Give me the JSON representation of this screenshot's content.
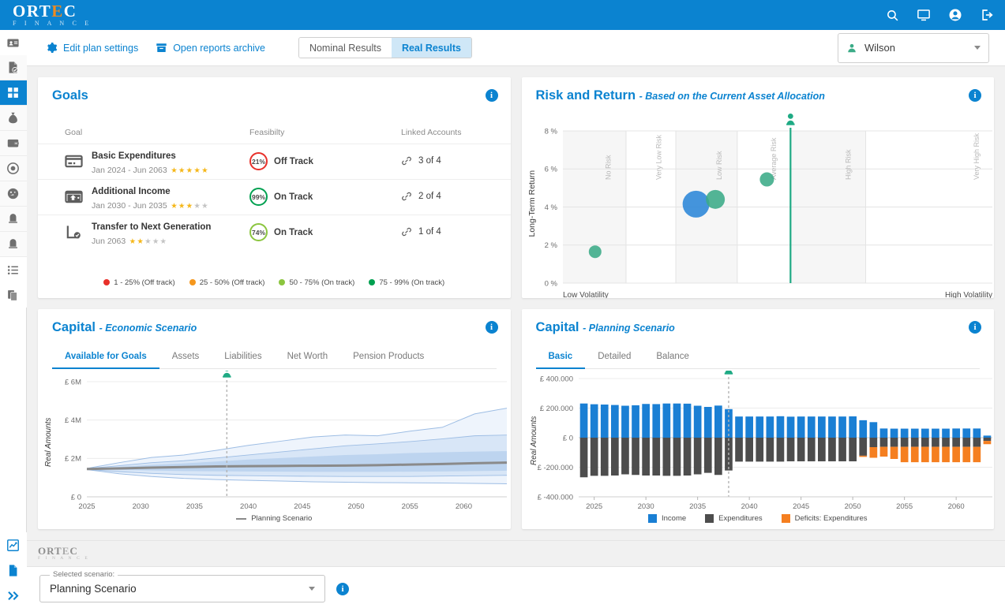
{
  "brand": {
    "name_main": "ORT",
    "name_e": "E",
    "name_tail": "C",
    "name_sub": "F I N A N C E"
  },
  "header": {
    "icons": [
      "search-icon",
      "monitor-icon",
      "account-icon",
      "logout-icon"
    ]
  },
  "toolbar": {
    "edit_plan_settings": "Edit plan settings",
    "open_reports_archive": "Open reports archive",
    "segments": [
      {
        "label": "Nominal Results",
        "active": false
      },
      {
        "label": "Real Results",
        "active": true
      }
    ],
    "user": "Wilson"
  },
  "sidebar": {
    "items": [
      {
        "name": "contact-card-icon",
        "active": false
      },
      {
        "name": "document-check-icon",
        "active": false
      },
      {
        "name": "dashboard-grid-icon",
        "active": true
      },
      {
        "name": "money-bag-icon",
        "active": false
      },
      {
        "name": "wallet-icon",
        "active": false
      },
      {
        "name": "target-icon",
        "active": false
      },
      {
        "name": "gauge-icon",
        "active": false
      },
      {
        "name": "bell-icon-1",
        "active": false
      },
      {
        "name": "bell-icon-2",
        "active": false
      },
      {
        "name": "list-icon",
        "active": false
      },
      {
        "name": "documents-icon",
        "active": false
      },
      {
        "name": "trend-chart-icon",
        "active": false
      },
      {
        "name": "file-icon",
        "active": false
      },
      {
        "name": "expand-chevrons-icon",
        "active": false
      }
    ]
  },
  "goals": {
    "title": "Goals",
    "info_label": "i",
    "columns": {
      "goal": "Goal",
      "feasibility": "Feasibilty",
      "linked": "Linked Accounts"
    },
    "rows": [
      {
        "icon": "card-icon",
        "name": "Basic Expenditures",
        "dates": "Jan 2024 - Jun 2063",
        "stars": 5,
        "feasibility_pct": "21%",
        "status": "Off Track",
        "ring_color": "#e8302a",
        "linked": "3 of 4"
      },
      {
        "icon": "income-card-icon",
        "name": "Additional Income",
        "dates": "Jan 2030 - Jun 2035",
        "stars": 3,
        "feasibility_pct": "99%",
        "status": "On Track",
        "ring_color": "#00a050",
        "linked": "2 of 4"
      },
      {
        "icon": "transfer-icon",
        "name": "Transfer to Next Generation",
        "dates": "Jun 2063",
        "stars": 2,
        "feasibility_pct": "74%",
        "status": "On Track",
        "ring_color": "#8bc53f",
        "linked": "1 of 4"
      }
    ],
    "legend": [
      {
        "label": "1 - 25% (Off track)",
        "color": "#e8302a"
      },
      {
        "label": "25 - 50% (Off track)",
        "color": "#f5971d"
      },
      {
        "label": "50 - 75% (On track)",
        "color": "#8bc53f"
      },
      {
        "label": "75 - 99% (On track)",
        "color": "#00a050"
      }
    ]
  },
  "risk_return": {
    "title": "Risk and Return",
    "subtitle": "- Based on the Current Asset Allocation",
    "info_label": "i"
  },
  "capital_economic": {
    "title": "Capital",
    "subtitle": "- Economic Scenario",
    "info_label": "i",
    "tabs": [
      {
        "label": "Available for Goals",
        "active": true
      },
      {
        "label": "Assets",
        "active": false
      },
      {
        "label": "Liabilities",
        "active": false
      },
      {
        "label": "Net Worth",
        "active": false
      },
      {
        "label": "Pension Products",
        "active": false
      }
    ]
  },
  "capital_planning": {
    "title": "Capital",
    "subtitle": "- Planning Scenario",
    "info_label": "i",
    "tabs": [
      {
        "label": "Basic",
        "active": true
      },
      {
        "label": "Detailed",
        "active": false
      },
      {
        "label": "Balance",
        "active": false
      }
    ]
  },
  "footer": {
    "scenario_legend": "Selected scenario:",
    "scenario_value": "Planning Scenario",
    "info_label": "i"
  },
  "chart_data": [
    {
      "id": "risk-return-bubble",
      "type": "scatter",
      "title": "Risk and Return - Based on the Current Asset Allocation",
      "xlabel_left": "Low Volatility",
      "xlabel_right": "High Volatility",
      "ylabel": "Long-Term Return",
      "ylim": [
        0,
        8
      ],
      "yticks": [
        "0 %",
        "2 %",
        "4 %",
        "6 %",
        "8 %"
      ],
      "grid": true,
      "band_labels": [
        "No Risk",
        "Very Low Risk",
        "Low Risk",
        "Average Risk",
        "High Risk",
        "Very High Risk"
      ],
      "marker_line": {
        "label": "Average Risk",
        "color": "#1faa84",
        "x_pct": 53.0
      },
      "points": [
        {
          "name": "no-risk-holding",
          "x_pct": 7.5,
          "y": 1.65,
          "r": 8,
          "color": "#3bab87"
        },
        {
          "name": "blue-allocation",
          "x_pct": 31.0,
          "y": 4.15,
          "r": 17,
          "color": "#2b86d8"
        },
        {
          "name": "green-allocation",
          "x_pct": 35.5,
          "y": 4.4,
          "r": 12,
          "color": "#3bab87"
        },
        {
          "name": "low-risk-holding",
          "x_pct": 47.5,
          "y": 5.45,
          "r": 9,
          "color": "#3bab87"
        }
      ]
    },
    {
      "id": "capital-economic-fan",
      "type": "area",
      "title": "Capital - Economic Scenario",
      "ylabel": "Real Amounts",
      "ylim": [
        0,
        6
      ],
      "yticks": [
        "£ 0",
        "£ 2M",
        "£ 4M",
        "£ 6M"
      ],
      "xticks": [
        "2025",
        "2030",
        "2035",
        "2040",
        "2045",
        "2050",
        "2055",
        "2060"
      ],
      "xlim": [
        2025,
        2064
      ],
      "grid": true,
      "legend": [
        {
          "label": "Planning Scenario",
          "color": "#8a8a8a",
          "kind": "line"
        }
      ],
      "marker_line": {
        "year": 2038,
        "color": "#1faa84",
        "style": "dashed"
      },
      "x": [
        2025,
        2028,
        2031,
        2034,
        2037,
        2040,
        2043,
        2046,
        2049,
        2052,
        2055,
        2058,
        2061,
        2064
      ],
      "series": [
        {
          "name": "p95-upper",
          "values": [
            1.48,
            1.78,
            2.05,
            2.18,
            2.42,
            2.68,
            2.9,
            3.12,
            3.22,
            3.18,
            3.42,
            3.62,
            4.32,
            4.62
          ],
          "color": "#e9f1fb"
        },
        {
          "name": "p75-upper",
          "values": [
            1.47,
            1.62,
            1.78,
            1.88,
            2.02,
            2.18,
            2.34,
            2.5,
            2.66,
            2.76,
            2.88,
            3.02,
            3.18,
            3.22
          ],
          "color": "#d3e2f5"
        },
        {
          "name": "p60-upper",
          "values": [
            1.46,
            1.56,
            1.66,
            1.74,
            1.84,
            1.94,
            2.02,
            2.1,
            2.18,
            2.22,
            2.28,
            2.32,
            2.36,
            2.38
          ],
          "color": "#bed4ef"
        },
        {
          "name": "median",
          "values": [
            1.45,
            1.48,
            1.52,
            1.55,
            1.58,
            1.6,
            1.61,
            1.62,
            1.63,
            1.65,
            1.68,
            1.71,
            1.75,
            1.78
          ],
          "color": "#8a8a8a"
        },
        {
          "name": "p40-lower",
          "values": [
            1.44,
            1.4,
            1.37,
            1.34,
            1.33,
            1.32,
            1.31,
            1.3,
            1.3,
            1.3,
            1.31,
            1.32,
            1.34,
            1.36
          ],
          "color": "#bed4ef"
        },
        {
          "name": "p25-lower",
          "values": [
            1.43,
            1.31,
            1.22,
            1.16,
            1.12,
            1.1,
            1.08,
            1.07,
            1.06,
            1.06,
            1.06,
            1.08,
            1.1,
            1.12
          ],
          "color": "#d3e2f5"
        },
        {
          "name": "p05-lower",
          "values": [
            1.42,
            1.2,
            1.06,
            0.96,
            0.9,
            0.86,
            0.82,
            0.78,
            0.76,
            0.74,
            0.73,
            0.72,
            0.7,
            0.68
          ],
          "color": "#e9f1fb"
        }
      ]
    },
    {
      "id": "capital-planning-bars",
      "type": "bar",
      "title": "Capital - Planning Scenario",
      "ylabel": "Real Amounts",
      "ylim": [
        -400000,
        400000
      ],
      "yticks": [
        "£ -400.000",
        "£ -200.000",
        "£ 0",
        "£ 200.000",
        "£ 400.000"
      ],
      "xticks": [
        "2025",
        "2030",
        "2035",
        "2040",
        "2045",
        "2050",
        "2055",
        "2060"
      ],
      "grid": true,
      "stacked": true,
      "marker_line": {
        "year": 2038,
        "color": "#1faa84",
        "style": "dashed"
      },
      "legend": [
        {
          "label": "Income",
          "color": "#1a7fd4"
        },
        {
          "label": "Expenditures",
          "color": "#4d4d4d"
        },
        {
          "label": "Deficits: Expenditures",
          "color": "#f57f20"
        }
      ],
      "categories": [
        2024,
        2025,
        2026,
        2027,
        2028,
        2029,
        2030,
        2031,
        2032,
        2033,
        2034,
        2035,
        2036,
        2037,
        2038,
        2039,
        2040,
        2041,
        2042,
        2043,
        2044,
        2045,
        2046,
        2047,
        2048,
        2049,
        2050,
        2051,
        2052,
        2053,
        2054,
        2055,
        2056,
        2057,
        2058,
        2059,
        2060,
        2061,
        2062,
        2063
      ],
      "series": [
        {
          "name": "Income",
          "color": "#1a7fd4",
          "values": [
            231000,
            226000,
            224000,
            221000,
            216000,
            219000,
            228000,
            227000,
            231000,
            231000,
            230000,
            216000,
            208000,
            217000,
            193000,
            143000,
            143000,
            143000,
            143000,
            145000,
            142000,
            143000,
            143000,
            143000,
            143000,
            143000,
            144000,
            118000,
            105000,
            62000,
            61000,
            61000,
            61000,
            61000,
            61000,
            61000,
            62000,
            62000,
            62000,
            14000
          ]
        },
        {
          "name": "Expenditures",
          "color": "#4d4d4d",
          "values": [
            -268000,
            -258000,
            -258000,
            -256000,
            -248000,
            -252000,
            -256000,
            -256000,
            -258000,
            -258000,
            -256000,
            -248000,
            -238000,
            -252000,
            -222000,
            -162000,
            -162000,
            -162000,
            -162000,
            -162000,
            -160000,
            -160000,
            -160000,
            -160000,
            -160000,
            -160000,
            -160000,
            -122000,
            -64000,
            -62000,
            -62000,
            -62000,
            -62000,
            -62000,
            -62000,
            -62000,
            -62000,
            -62000,
            -62000,
            -22000
          ]
        },
        {
          "name": "Deficits: Expenditures",
          "color": "#f57f20",
          "values": [
            0,
            0,
            0,
            0,
            0,
            0,
            0,
            0,
            0,
            0,
            0,
            0,
            0,
            0,
            0,
            0,
            0,
            0,
            0,
            0,
            0,
            0,
            0,
            0,
            0,
            0,
            0,
            -8000,
            -72000,
            -66000,
            -82000,
            -104000,
            -104000,
            -104000,
            -104000,
            -104000,
            -104000,
            -104000,
            -104000,
            -22000
          ]
        }
      ]
    }
  ]
}
